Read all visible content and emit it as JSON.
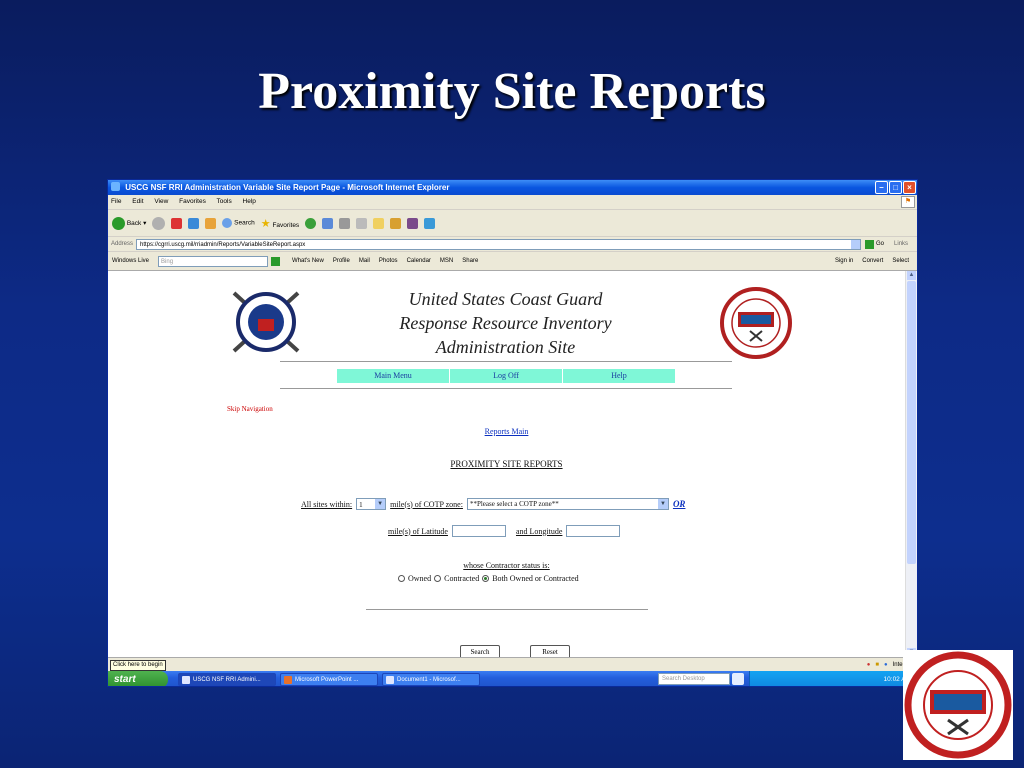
{
  "slide": {
    "title": "Proximity Site Reports"
  },
  "window": {
    "title": "USCG NSF RRI Administration Variable Site Report Page - Microsoft Internet Explorer",
    "menu": [
      "File",
      "Edit",
      "View",
      "Favorites",
      "Tools",
      "Help"
    ],
    "toolbar": {
      "back": "Back",
      "search": "Search",
      "favorites": "Favorites"
    },
    "address": {
      "label": "Address",
      "url": "https://cgrri.uscg.mil/rriadmin/Reports/VariableSiteReport.aspx",
      "go": "Go",
      "links": "Links"
    },
    "livebar": {
      "brand": "Windows Live",
      "search_placeholder": "Bing",
      "items": [
        "What's New",
        "Profile",
        "Mail",
        "Photos",
        "Calendar",
        "MSN",
        "Share"
      ],
      "sign_in": "Sign in",
      "convert": "Convert",
      "select": "Select"
    }
  },
  "page": {
    "header_lines": [
      "United States Coast Guard",
      "Response Resource Inventory",
      "Administration Site"
    ],
    "nav": [
      "Main Menu",
      "Log Off",
      "Help"
    ],
    "skip_nav": "Skip Navigation",
    "reports_main": "Reports Main",
    "heading": "PROXIMITY SITE REPORTS",
    "form": {
      "all_sites_label": "All sites within:",
      "miles_value": "1",
      "cotp_label": "mile(s) of COTP zone:",
      "cotp_selected": "**Please select a COTP zone**",
      "or_link": "OR",
      "latitude_label": "mile(s) of Latitude",
      "longitude_label": "and Longitude",
      "status_label": "whose Contractor status is:",
      "radio_options": [
        {
          "label": "Owned",
          "checked": false
        },
        {
          "label": "Contracted",
          "checked": false
        },
        {
          "label": "Both Owned or Contracted",
          "checked": true
        }
      ],
      "search_button": "Search",
      "reset_button": "Reset"
    }
  },
  "status_bar": {
    "tooltip": "Click here to begin",
    "zone": "Internet"
  },
  "taskbar": {
    "start": "start",
    "tasks": [
      "USCG NSF RRI Admini...",
      "Microsoft PowerPoint ...",
      "Document1 - Microsof..."
    ],
    "search_placeholder": "Search Desktop",
    "clock": "10:02 AM"
  },
  "colors": {
    "slide_bg": "#0d2a86",
    "nav_bg": "#7ff7d7",
    "link": "#0a2fbf",
    "skip_nav": "#cc0000"
  }
}
